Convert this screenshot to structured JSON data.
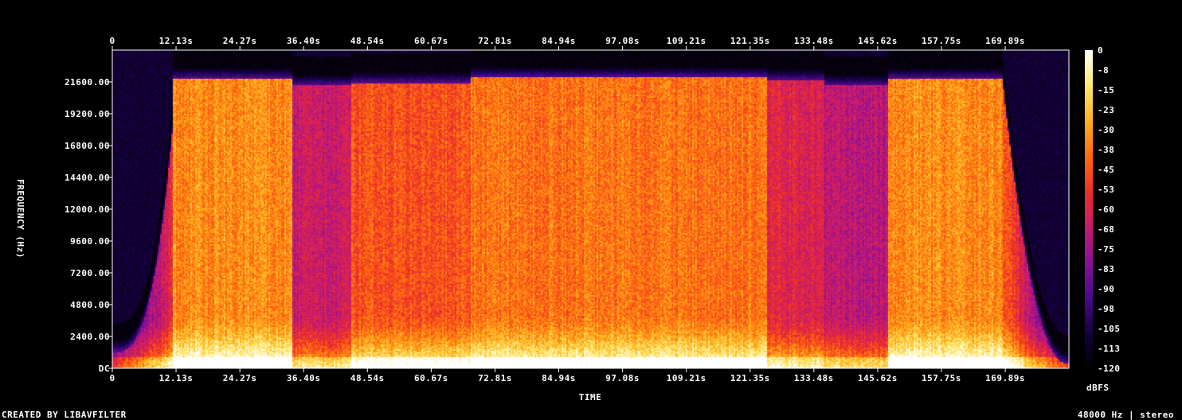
{
  "chart_data": {
    "type": "heatmap",
    "xlabel": "TIME",
    "ylabel": "FREQUENCY (Hz)",
    "x_ticks": [
      "0",
      "12.13s",
      "24.27s",
      "36.40s",
      "48.54s",
      "60.67s",
      "72.81s",
      "84.94s",
      "97.08s",
      "109.21s",
      "121.35s",
      "133.48s",
      "145.62s",
      "157.75s",
      "169.89s"
    ],
    "x_tick_values": [
      0,
      12.13,
      24.27,
      36.4,
      48.54,
      60.67,
      72.81,
      84.94,
      97.08,
      109.21,
      121.35,
      133.48,
      145.62,
      157.75,
      169.89
    ],
    "xlim": [
      0,
      182
    ],
    "y_ticks": [
      "DC",
      "2400.00",
      "4800.00",
      "7200.00",
      "9600.00",
      "12000.00",
      "14400.00",
      "16800.00",
      "19200.00",
      "21600.00"
    ],
    "y_tick_values": [
      0,
      2400,
      4800,
      7200,
      9600,
      12000,
      14400,
      16800,
      19200,
      21600
    ],
    "ylim": [
      0,
      24000
    ],
    "colorbar": {
      "label": "dBFS",
      "ticks": [
        "0",
        "-8",
        "-15",
        "-23",
        "-30",
        "-38",
        "-45",
        "-53",
        "-60",
        "-68",
        "-75",
        "-83",
        "-90",
        "-98",
        "-105",
        "-113",
        "-120"
      ],
      "range": [
        -120,
        0
      ],
      "colors": [
        "#000000",
        "#160040",
        "#4a0a8c",
        "#8a1098",
        "#c81a6e",
        "#ec2f2a",
        "#ff6a10",
        "#ffb01e",
        "#ffe870",
        "#ffffff"
      ]
    },
    "sections": [
      {
        "start": 0,
        "end": 11.5,
        "level": 0.18,
        "ceiling": 2800,
        "ramp": "rise"
      },
      {
        "start": 11.5,
        "end": 34.2,
        "level": 0.72,
        "ceiling": 21800
      },
      {
        "start": 34.2,
        "end": 45.5,
        "level": 0.45,
        "ceiling": 21300
      },
      {
        "start": 45.5,
        "end": 68.3,
        "level": 0.62,
        "ceiling": 21500
      },
      {
        "start": 68.3,
        "end": 124.6,
        "level": 0.68,
        "ceiling": 21900
      },
      {
        "start": 124.6,
        "end": 135.5,
        "level": 0.5,
        "ceiling": 21700
      },
      {
        "start": 135.5,
        "end": 147.5,
        "level": 0.42,
        "ceiling": 21300
      },
      {
        "start": 147.5,
        "end": 169.5,
        "level": 0.72,
        "ceiling": 21800
      },
      {
        "start": 169.5,
        "end": 182,
        "level": 0.35,
        "ceiling": 21000,
        "ramp": "fall"
      }
    ]
  },
  "footer": {
    "left": "CREATED BY LIBAVFILTER",
    "right": "48000 Hz | stereo"
  }
}
